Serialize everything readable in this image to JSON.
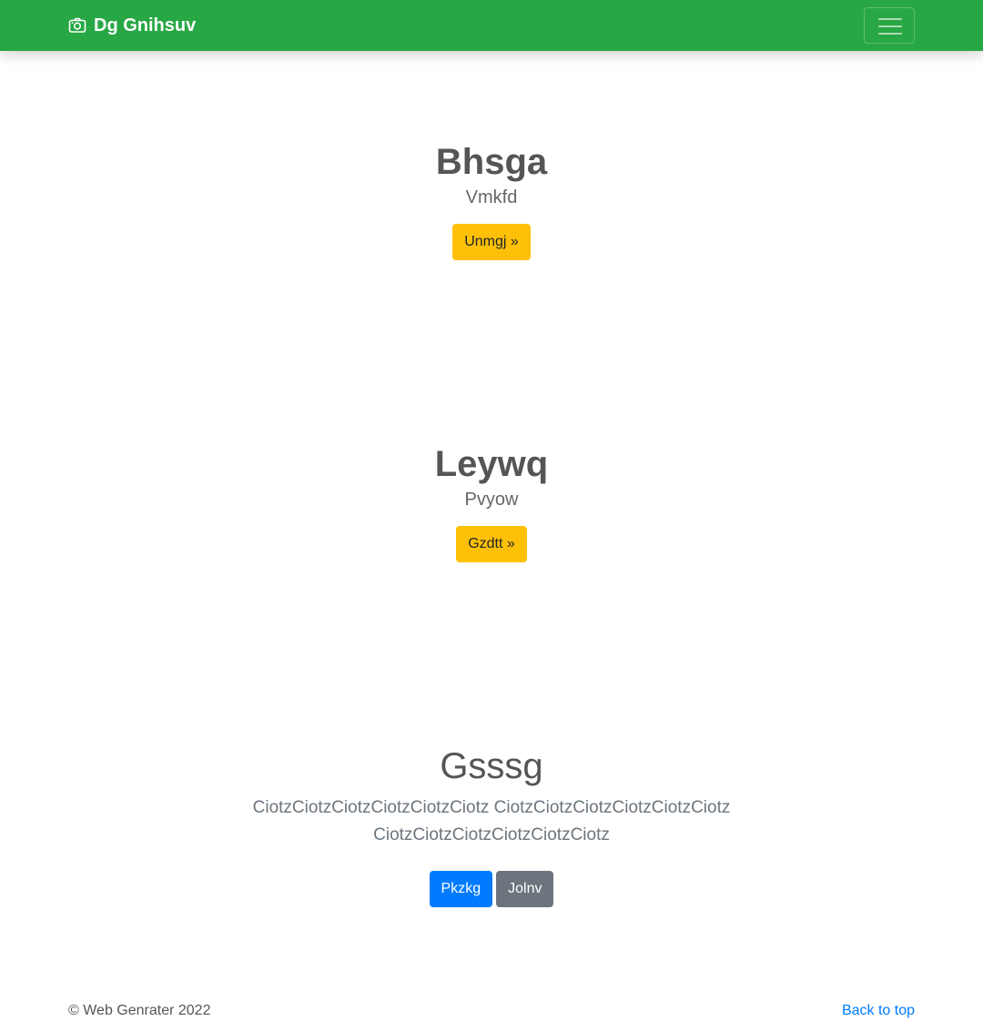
{
  "colors": {
    "brand": "#28a745",
    "warning": "#ffc107",
    "primary": "#007bff",
    "secondary": "#6c757d",
    "link": "#007bff"
  },
  "navbar": {
    "brand_icon": "camera-icon",
    "brand_text": "Dg Gnihsuv",
    "toggler_icon": "hamburger-menu-icon"
  },
  "sections": [
    {
      "title": "Bhsga",
      "lead": "Vmkfd",
      "button": "Unmgj »"
    },
    {
      "title": "Leywq",
      "lead": "Pvyow",
      "button": "Gzdtt »"
    },
    {
      "title": "Gsssg",
      "lead": "CiotzCiotzCiotzCiotzCiotzCiotz CiotzCiotzCiotzCiotzCiotzCiotz CiotzCiotzCiotzCiotzCiotzCiotz",
      "buttons": [
        "Pkzkg",
        "Jolnv"
      ]
    }
  ],
  "footer": {
    "copyright": "© Web Genrater 2022",
    "back_to_top": "Back to top"
  }
}
